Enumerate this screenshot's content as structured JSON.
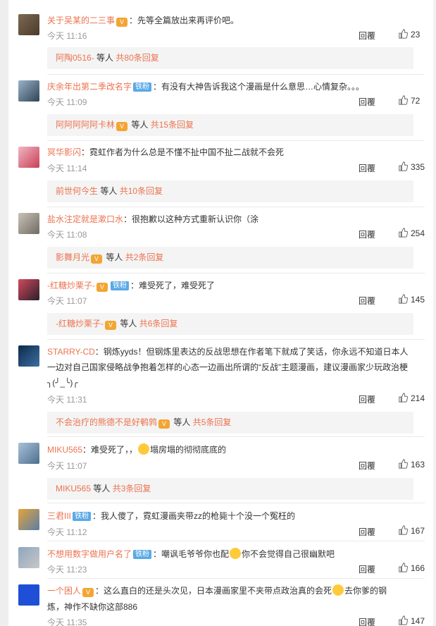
{
  "ui": {
    "reply_label": "回覆",
    "people_suffix": "等人",
    "vip_text": "V",
    "fan_badge": "铁粉"
  },
  "colors": {
    "name": "#eb7350",
    "badge": "#5aa9e6",
    "vip": "#f3a533",
    "subbg": "#f4f4f4"
  },
  "comments": [
    {
      "user": "关于吴某的二三事",
      "vip": true,
      "text": "：先等全篇放出来再评价吧。",
      "time": "今天 11:16",
      "likes": "23",
      "replies": {
        "users": "阿陶0516-",
        "vip": false,
        "count": "共80条回复"
      }
    },
    {
      "user": "庆余年出第二季改名字",
      "badge": "铁粉",
      "text": "：有没有大神告诉我这个漫画是什么意思…心情复杂。。。",
      "time": "今天 11:09",
      "likes": "72",
      "replies": {
        "users": "阿阿阿阿阿卡林",
        "vip": true,
        "count": "共15条回复"
      }
    },
    {
      "user": "冥华影闪",
      "text": "：霓虹作者为什么总是不懂不扯中国不扯二战就不会死",
      "time": "今天 11:14",
      "likes": "335",
      "replies": {
        "users": "前世何今生",
        "vip": false,
        "count": "共10条回复"
      }
    },
    {
      "user": "盐水注定就是漱口水",
      "text": "：很抱歉以这种方式重新认识你（涂",
      "time": "今天 11:08",
      "likes": "254",
      "replies": {
        "users": "影舞月光",
        "vip": true,
        "count": "共2条回复"
      }
    },
    {
      "user": "-红糖炒栗子-",
      "vip": true,
      "badge": "铁粉",
      "text": "：难受死了，难受死了",
      "time": "今天 11:07",
      "likes": "145",
      "replies": {
        "users": "-红糖炒栗子-",
        "vip": true,
        "count": "共6条回复"
      }
    },
    {
      "user": "STARRY-CD",
      "text": "：钢炼yyds！但钢炼里表达的反战思想在作者笔下就成了笑话，你永远不知道日本人",
      "line2": "一边对自己国家侵略战争抱着怎样的心态一边画出所谓的“反战”主题漫画，建议漫画家少玩政治梗",
      "line3": "╮(╯_╰)╭",
      "time": "今天 11:31",
      "likes": "214",
      "replies": {
        "users": "不会治疗的熊德不是好鹌鹑",
        "vip": true,
        "count": "共5条回复"
      }
    },
    {
      "user": "MIKU565",
      "text": "：难受死了，，",
      "text2": "塌房塌的彻彻底底的",
      "time": "今天 11:07",
      "likes": "163",
      "replies": {
        "users": "MIKU565",
        "vip": false,
        "count": "共3条回复"
      }
    },
    {
      "user": "三君III",
      "badge": "铁粉",
      "text": "：我人傻了，霓虹漫画夹带zz的枪毙十个没一个冤枉的",
      "time": "今天 11:12",
      "likes": "167"
    },
    {
      "user": "不想用数字做用户名了",
      "badge": "铁粉",
      "text": "：嘲讽毛爷爷你也配",
      "text2": "你不会觉得自己很幽默吧",
      "time": "今天 11:23",
      "likes": "166"
    },
    {
      "user": "一个困人",
      "vip": true,
      "text": "：这么直白的还是头次见，日本漫画家里不夹带点政治真的会死",
      "text2": "去你爹的钢",
      "line2": "炼，神作不缺你这部886",
      "time": "今天 11:35",
      "likes": "147"
    }
  ]
}
